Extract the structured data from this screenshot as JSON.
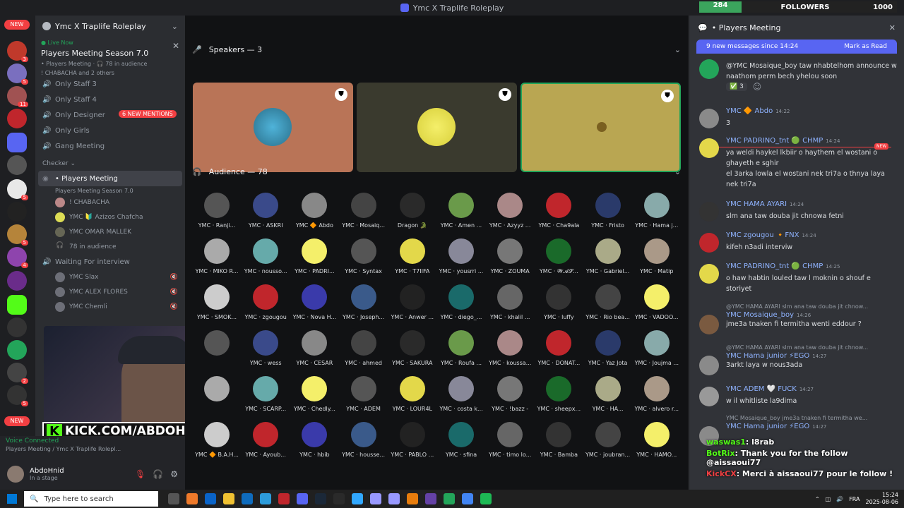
{
  "window": {
    "title": "Ymc X Traplife Roleplay"
  },
  "followers": {
    "count": "284",
    "label": "FOLLOWERS",
    "goal": "1000"
  },
  "rail": {
    "new_top": "NEW",
    "new_bottom": "NEW",
    "badges": [
      "3",
      "5",
      "11",
      "5",
      "5",
      "4",
      "2",
      "5"
    ]
  },
  "sidebar": {
    "server_name": "Ymc X Traplife Roleplay",
    "live_tag": "Live Now",
    "live_title": "Players Meeting Season 7.0",
    "live_sub": "• Players Meeting · 🎧 78 in audience",
    "live_sub2": "! CHABACHA and 2 others",
    "mentions": "6 NEW MENTIONS",
    "channels": [
      "Only Staff 3",
      "Only Staff 4",
      "Only Designer",
      "Only Girls",
      "Gang Meeting"
    ],
    "checker_cat": "Checker",
    "active_channel": "• Players Meeting",
    "active_sub": "Players Meeting Season 7.0",
    "stage_members": [
      "! CHABACHA",
      "YMC 🔰 Azizos Chafcha",
      "YMC OMAR MALLEK"
    ],
    "in_audience": "78 in audience",
    "waiting_channel": "Waiting For interview",
    "waiting_members": [
      "YMC Slax",
      "YMC ALEX FLORES",
      "YMC Chemli"
    ],
    "voice_connected": "Voice Connected",
    "voice_sub": "Players Meeting / Ymc X Traplife Rolepl...",
    "kick_text": "KICK.COM/ABDOHNID",
    "user_name": "AbdoHnid",
    "user_status": "In a stage"
  },
  "stage": {
    "speakers_label": "Speakers — 3",
    "audience_label": "Audience — 78",
    "audience": [
      "YMC · Ranji...",
      "YMC · ASKRI",
      "YMC 🔶 Abdo",
      "YMC · Mosaiq...",
      "Dragon 🐊",
      "YMC · Amen ...",
      "YMC · Azyyz ...",
      "YMC · Cha9ala",
      "YMC · Fristo",
      "YMC · Hama j...",
      "YMC · MIKO R...",
      "YMC · nousso...",
      "YMC · PADRI...",
      "YMC · Syntax",
      "YMC · T7IIFA",
      "YMC · yousrri ...",
      "YMC · ZOUMA",
      "YMC · 𝓦𝓐𝓢...",
      "YMC · Gabriel...",
      "YMC · Matip",
      "YMC · SMOK...",
      "YMC · zgougou",
      "YMC · Nova H...",
      "YMC · Joseph...",
      "YMC · Anwer ...",
      "YMC · diego_...",
      "YMC · khalil ...",
      "YMC · luffy",
      "YMC · Rio bea...",
      "YMC · VADOO...",
      "",
      "YMC · wess",
      "YMC · CESAR",
      "YMC · ahmed",
      "YMC · SAKURA",
      "YMC · Roufa ...",
      "YMC · koussa...",
      "YMC · DONAT...",
      "YMC · Yaz Jota",
      "YMC · Joujma ...",
      "",
      "YMC · SCARP...",
      "YMC · Chedly...",
      "YMC · ADEM",
      "YMC · LOUR4L",
      "YMC · costa k...",
      "YMC · !bazz -",
      "YMC · sheepx...",
      "YMC · HA...",
      "YMC · alvero r...",
      "YMC 🔶 B.A.H...",
      "YMC · Ayoub...",
      "YMC · hbib",
      "YMC · housse...",
      "YMC · PABLO ...",
      "YMC · sfina",
      "YMC · timo lo...",
      "YMC · Bamba",
      "YMC · joubran...",
      "YMC · HAMO..."
    ]
  },
  "chat": {
    "channel": "• Players Meeting",
    "new_messages": "9 new messages since 14:24",
    "mark_read": "Mark as Read",
    "messages": [
      {
        "author": "",
        "time": "",
        "reply": "",
        "body": "@YMC Mosaique_boy taw nhabtelhom announce w naathom perm bech yhelou soon"
      },
      {
        "author": "YMC 🔶 Abdo",
        "time": "14:22",
        "reply": "",
        "body": "3"
      },
      {
        "author": "YMC PADRINO_tnt 🟢 CHMP",
        "time": "14:24",
        "reply": "",
        "body": "ya weldi haykel lkbiir o haythem el wostani o ghayeth e sghir\nel 3arka lowla el wostani nek tri7a o thnya laya nek tri7a"
      },
      {
        "author": "YMC HAMA AYARI",
        "time": "14:24",
        "reply": "",
        "body": "slm ana taw douba jit chnowa fetni"
      },
      {
        "author": "YMC zgougou 🔸FNX",
        "time": "14:24",
        "reply": "",
        "body": "kifeh n3adi interviw"
      },
      {
        "author": "YMC PADRINO_tnt 🟢 CHMP",
        "time": "14:25",
        "reply": "",
        "body": "o haw habtin louled taw l moknin o shouf e storiyet"
      },
      {
        "author": "YMC Mosaique_boy",
        "time": "14:26",
        "reply": "@YMC HAMA AYARI slm ana taw douba jit chnow...",
        "body": "jme3a tnaken fi termitha wenti eddour ?"
      },
      {
        "author": "YMC Hama junior ⚡EGO",
        "time": "14:27",
        "reply": "@YMC HAMA AYARI slm ana taw douba jit chnow...",
        "body": "3arkt laya w nous3ada"
      },
      {
        "author": "YMC ADEM 🤍 FUCK",
        "time": "14:27",
        "reply": "",
        "body": "w il whitliste la9dima"
      },
      {
        "author": "YMC Hama junior ⚡EGO",
        "time": "14:27",
        "reply": "YMC Mosaique_boy jme3a tnaken fi termitha we...",
        "body": ""
      }
    ],
    "reactions": [
      "✅ 3"
    ],
    "new_tag": "NEW"
  },
  "overlay": [
    {
      "user": "waswas1",
      "text": ": l8rab"
    },
    {
      "user": "BotRix",
      "text": ": Thank you for the follow @aissaoui77"
    },
    {
      "user": "KickCX",
      "text": ": Merci à aissaoui77 pour le follow !"
    }
  ],
  "taskbar": {
    "search_placeholder": "Type here to search",
    "lang": "FRA",
    "time": "15:24",
    "date": "2025-08-06"
  }
}
